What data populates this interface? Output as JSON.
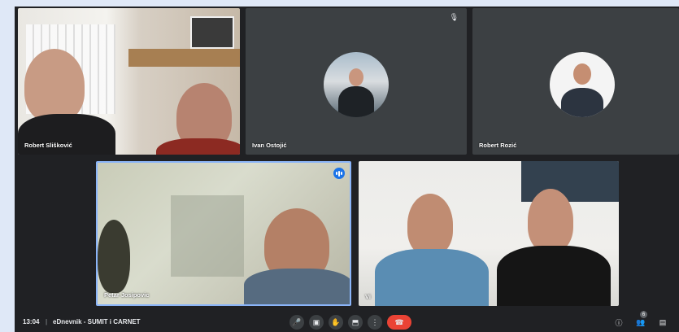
{
  "participants": [
    {
      "name": "Robert Slišković"
    },
    {
      "name": "Ivan Ostojić"
    },
    {
      "name": "Robert Rozić"
    },
    {
      "name": "Petar Josipovic"
    },
    {
      "name": "Vi"
    }
  ],
  "footer": {
    "time": "13:04",
    "separator": "|",
    "meeting_title": "eDnevnik - SUMIT i CARNET",
    "participant_count": "6"
  },
  "controls": [
    {
      "icon": "microphone-icon",
      "glyph": "🎤"
    },
    {
      "icon": "camera-icon",
      "glyph": "▣"
    },
    {
      "icon": "raise-hand-icon",
      "glyph": "✋"
    },
    {
      "icon": "present-screen-icon",
      "glyph": "⬒"
    },
    {
      "icon": "more-options-icon",
      "glyph": "⋮"
    },
    {
      "icon": "end-call-icon",
      "glyph": "☎"
    }
  ],
  "right_icons": [
    {
      "icon": "info-icon",
      "glyph": "ⓘ"
    },
    {
      "icon": "people-icon",
      "glyph": "👥"
    },
    {
      "icon": "chat-icon",
      "glyph": "▤"
    }
  ]
}
